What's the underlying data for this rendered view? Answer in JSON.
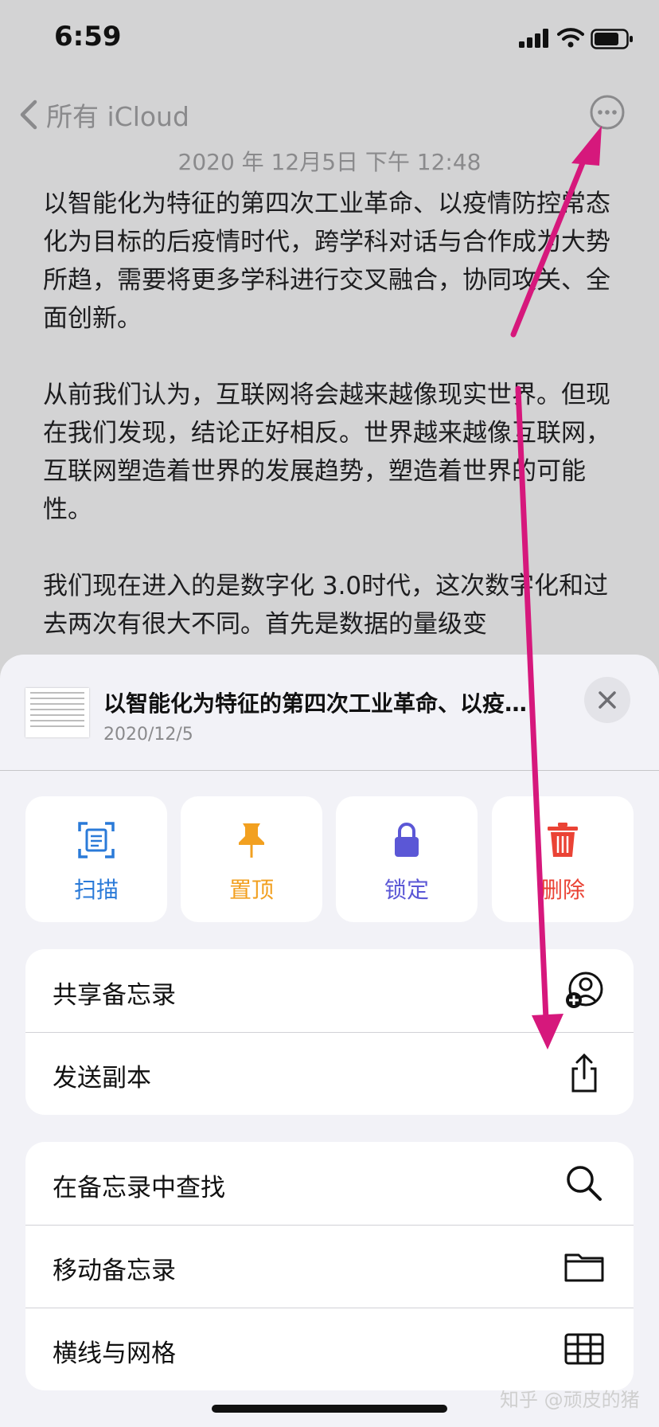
{
  "status": {
    "time": "6:59"
  },
  "nav": {
    "back_label": "所有 iCloud"
  },
  "note": {
    "date": "2020 年 12月5日 下午 12:48",
    "paragraphs": [
      "以智能化为特征的第四次工业革命、以疫情防控常态化为目标的后疫情时代，跨学科对话与合作成为大势所趋，需要将更多学科进行交叉融合，协同攻关、全面创新。",
      "从前我们认为，互联网将会越来越像现实世界。但现在我们发现，结论正好相反。世界越来越像互联网，互联网塑造着世界的发展趋势，塑造着世界的可能性。",
      "我们现在进入的是数字化 3.0时代，这次数字化和过去两次有很大不同。首先是数据的量级变"
    ]
  },
  "sheet": {
    "title": "以智能化为特征的第四次工业革命、以疫…",
    "subtitle": "2020/12/5",
    "actions": [
      {
        "label": "扫描",
        "icon": "scan-icon",
        "color": "#2a7ad8"
      },
      {
        "label": "置顶",
        "icon": "pin-icon",
        "color": "#f2a020"
      },
      {
        "label": "锁定",
        "icon": "lock-icon",
        "color": "#5b57d6"
      },
      {
        "label": "删除",
        "icon": "trash-icon",
        "color": "#ea4335"
      }
    ],
    "group1": [
      {
        "label": "共享备忘录",
        "icon": "share-person-icon"
      },
      {
        "label": "发送副本",
        "icon": "share-icon"
      }
    ],
    "group2": [
      {
        "label": "在备忘录中查找",
        "icon": "search-icon"
      },
      {
        "label": "移动备忘录",
        "icon": "folder-icon"
      },
      {
        "label": "横线与网格",
        "icon": "grid-icon"
      }
    ]
  },
  "watermark": "知乎 @顽皮的猪",
  "colors": {
    "annotation": "#d6187c",
    "background": "#d3d3d4",
    "sheet": "#f2f2f7"
  }
}
